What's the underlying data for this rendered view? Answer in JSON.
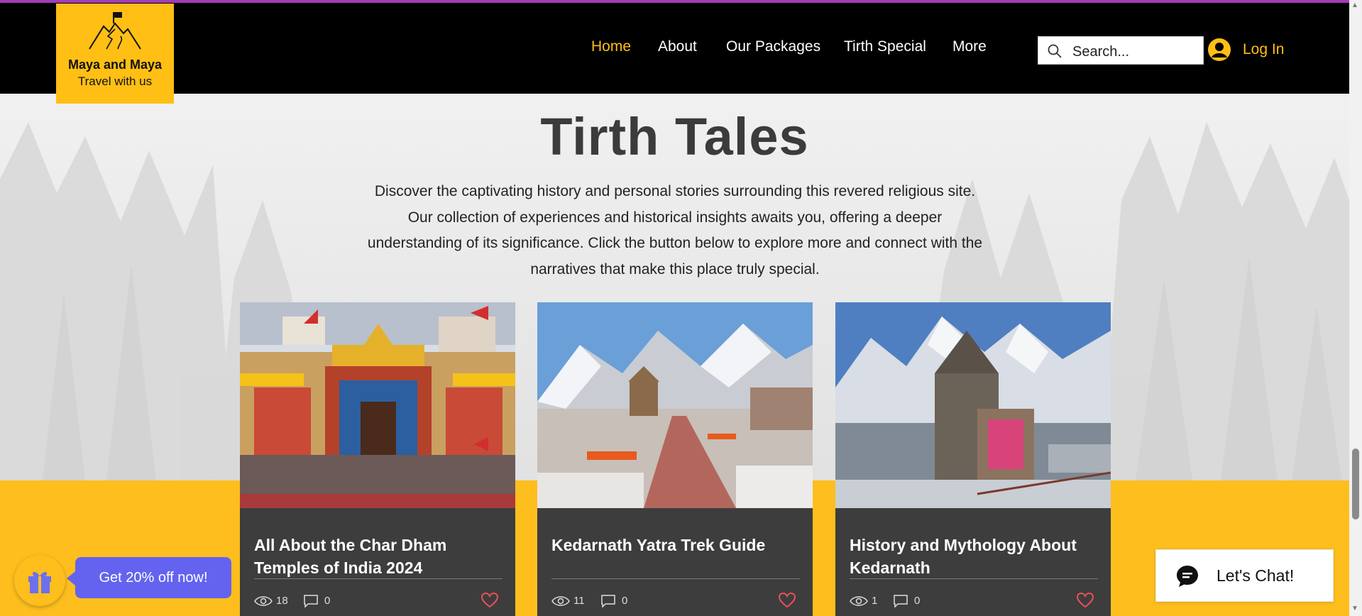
{
  "brand": {
    "name": "Maya and Maya",
    "tagline": "Travel with us"
  },
  "nav": {
    "items": [
      {
        "label": "Home",
        "active": true
      },
      {
        "label": "About",
        "active": false
      },
      {
        "label": "Our Packages",
        "active": false
      },
      {
        "label": "Tirth Special",
        "active": false
      },
      {
        "label": "More",
        "active": false
      }
    ]
  },
  "search": {
    "placeholder": "Search..."
  },
  "login": {
    "label": "Log In"
  },
  "hero": {
    "title": "Tirth Tales",
    "intro": "Discover the captivating history and personal stories surrounding this revered religious site. Our collection of experiences and historical insights awaits you, offering a deeper understanding of its significance. Click the button below to explore more and connect with the narratives that make this place truly special."
  },
  "posts": [
    {
      "title": "All About the Char Dham Temples of India 2024",
      "views": "18",
      "comments": "0"
    },
    {
      "title": "Kedarnath Yatra Trek Guide",
      "views": "11",
      "comments": "0"
    },
    {
      "title": "History and Mythology About Kedarnath",
      "views": "1",
      "comments": "0"
    }
  ],
  "promo": {
    "label": "Get 20% off now!"
  },
  "chat": {
    "label": "Let's Chat!"
  },
  "colors": {
    "accent": "#ffbf14",
    "header_bg": "#000000",
    "card_bg": "#3d3d3d",
    "promo_bg": "#6363f0",
    "heart": "#e8505b",
    "top_line": "#a23bb7"
  }
}
